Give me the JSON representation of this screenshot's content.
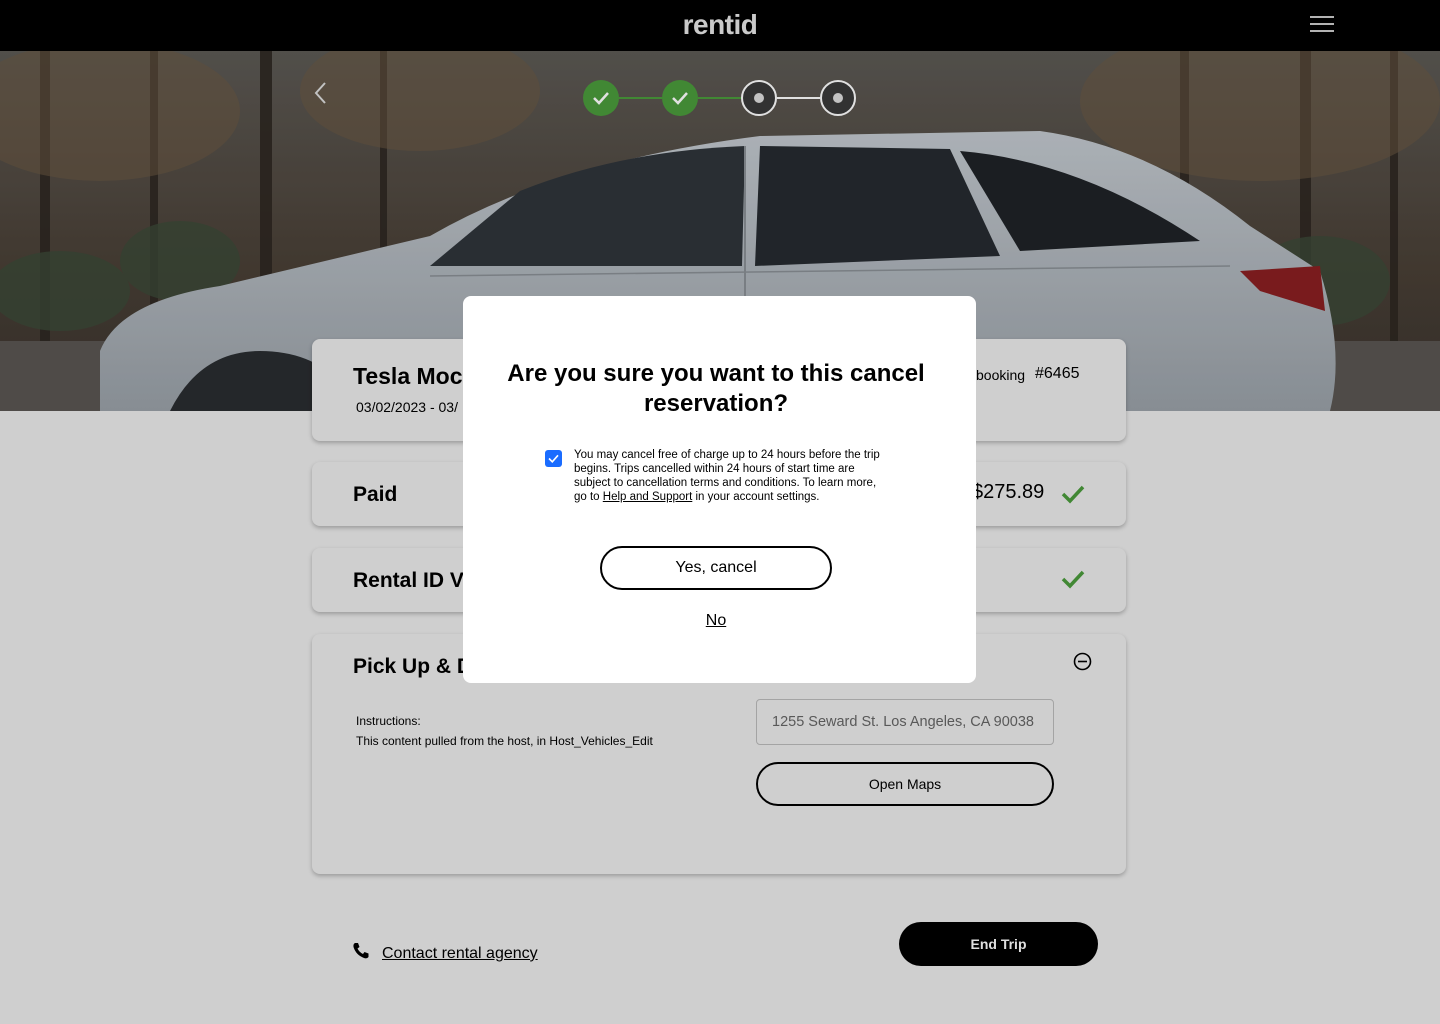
{
  "header": {
    "logo": "rentid",
    "menu_icon": "hamburger-icon"
  },
  "stepper": {
    "steps": [
      {
        "state": "done"
      },
      {
        "state": "done"
      },
      {
        "state": "todo"
      },
      {
        "state": "todo"
      }
    ],
    "colors": {
      "done": "#4b9b3c",
      "line_done": "#4b9b3c",
      "line_todo": "#ffffff"
    }
  },
  "booking": {
    "vehicle": "Tesla Moc",
    "dates": "03/02/2023 - 03/",
    "booking_label": "booking",
    "booking_number": "#6465"
  },
  "paid": {
    "label": "Paid",
    "amount": "$275.89"
  },
  "rental_id": {
    "label": "Rental ID Ve"
  },
  "pickup": {
    "label": "Pick Up & D",
    "instructions_label": "Instructions:",
    "instructions_text": "This content pulled  from the host, in Host_Vehicles_Edit",
    "address": "1255 Seward St. Los Angeles, CA  90038",
    "open_maps_label": "Open Maps"
  },
  "footer": {
    "contact_label": "Contact rental agency",
    "end_trip_label": "End Trip"
  },
  "modal": {
    "title": "Are you sure you want to this cancel reservation?",
    "checkbox_checked": true,
    "policy_text_before": "You may cancel free of charge up to 24 hours before the trip begins.  Trips cancelled within 24 hours of start time are subject to cancellation terms and conditions. To learn more, go to ",
    "policy_link": "Help and Support",
    "policy_text_after": " in your account settings.",
    "yes_label": "Yes, cancel",
    "no_label": "No"
  },
  "colors": {
    "accent_green": "#4b9b3c",
    "checkbox_blue": "#1a6cff",
    "primary": "#000000"
  }
}
